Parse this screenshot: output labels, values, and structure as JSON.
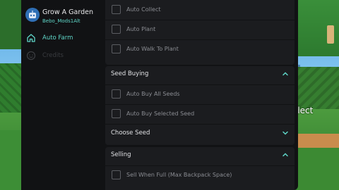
{
  "app": {
    "title": "Grow A Garden",
    "username": "Bebo_Mods1Alt"
  },
  "sidebar": {
    "items": [
      {
        "label": "Auto Farm",
        "icon": "home-icon",
        "active": true
      },
      {
        "label": "Credits",
        "icon": "smiley-icon",
        "active": false
      }
    ]
  },
  "sections": {
    "auto": {
      "toggles": [
        {
          "label": "Auto Collect",
          "checked": false
        },
        {
          "label": "Auto Plant",
          "checked": false
        },
        {
          "label": "Auto Walk To Plant",
          "checked": false
        }
      ]
    },
    "seed_buying": {
      "title": "Seed Buying",
      "expanded": true,
      "toggles": [
        {
          "label": "Auto Buy All Seeds",
          "checked": false
        },
        {
          "label": "Auto Buy Selected Seed",
          "checked": false
        }
      ],
      "dropdown_label": "Choose Seed"
    },
    "selling": {
      "title": "Selling",
      "expanded": true,
      "toggles": [
        {
          "label": "Sell When Full (Max Backpack Space)",
          "checked": false
        }
      ]
    }
  },
  "background": {
    "collect_text": "llect"
  },
  "colors": {
    "accent": "#5fd6c8",
    "window_bg": "#111214",
    "section_bg": "#1b1c1f",
    "muted_text": "#8a8c92",
    "header_text": "#e2e3e6"
  }
}
